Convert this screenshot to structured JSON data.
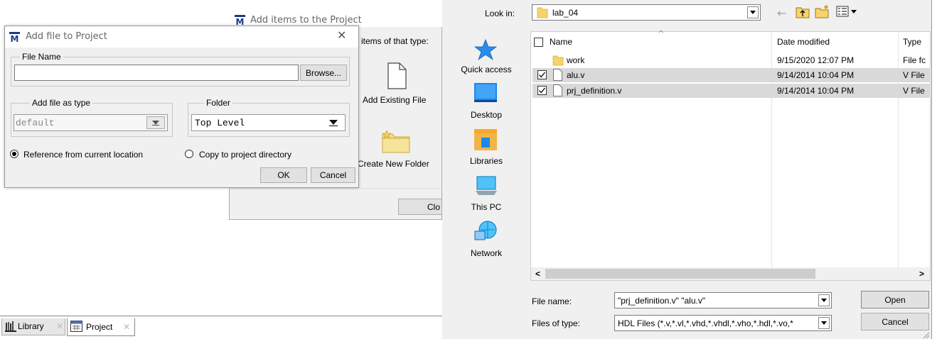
{
  "add_items": {
    "title": "Add items to the Project",
    "subtitle": "items of that type:",
    "add_existing": "Add Existing File",
    "create_folder": "Create New Folder",
    "close_label": "Clo"
  },
  "add_file": {
    "title": "Add file to Project",
    "file_name_group": "File Name",
    "file_name_value": "",
    "browse": "Browse...",
    "type_group": "Add file as type",
    "type_value": "default",
    "folder_group": "Folder",
    "folder_value": "Top Level",
    "radio_reference": "Reference from current location",
    "radio_copy": "Copy to project directory",
    "ok": "OK",
    "cancel": "Cancel"
  },
  "bottom_tabs": {
    "library": "Library",
    "project": "Project"
  },
  "open_dialog": {
    "look_in_label": "Look in:",
    "look_in_value": "lab_04",
    "places": [
      "Quick access",
      "Desktop",
      "Libraries",
      "This PC",
      "Network"
    ],
    "columns": {
      "name": "Name",
      "date": "Date modified",
      "type": "Type"
    },
    "files": [
      {
        "name": "work",
        "date": "9/15/2020 12:07 PM",
        "type": "File fc",
        "checked": false,
        "selected": false
      },
      {
        "name": "alu.v",
        "date": "9/14/2014 10:04 PM",
        "type": "V File",
        "checked": true,
        "selected": true
      },
      {
        "name": "prj_definition.v",
        "date": "9/14/2014 10:04 PM",
        "type": "V File",
        "checked": true,
        "selected": true
      }
    ],
    "file_name_label": "File name:",
    "file_name_value": "\"prj_definition.v\" \"alu.v\"",
    "file_type_label": "Files of type:",
    "file_type_value": "HDL Files (*.v,*.vl,*.vhd,*.vhdl,*.vho,*.hdl,*.vo,*",
    "open": "Open",
    "cancel": "Cancel",
    "scroll_left": "<",
    "scroll_right": ">"
  },
  "colors": {
    "window_bg": "#f0f0f0",
    "selection": "#d9d9d9",
    "folder": "#f6d36b",
    "quick_access": "#1e90ff"
  }
}
